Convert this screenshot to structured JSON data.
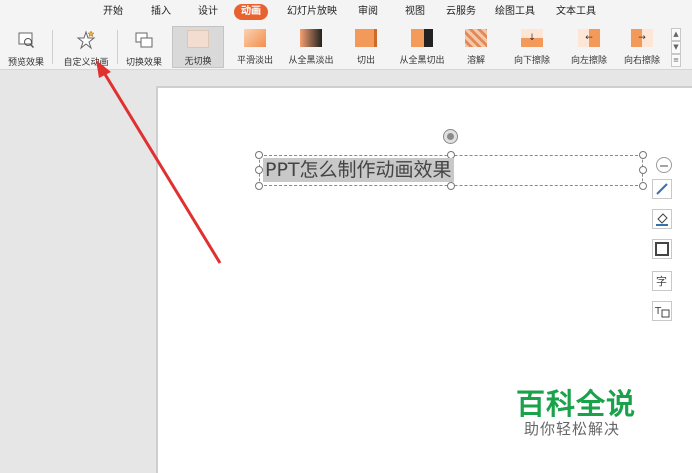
{
  "menu": {
    "tabs": [
      {
        "label": "开始"
      },
      {
        "label": "插入"
      },
      {
        "label": "设计"
      },
      {
        "label": "动画",
        "active": true
      },
      {
        "label": "幻灯片放映"
      },
      {
        "label": "审阅"
      },
      {
        "label": "视图"
      },
      {
        "label": "云服务"
      },
      {
        "label": "绘图工具"
      },
      {
        "label": "文本工具"
      }
    ]
  },
  "ribbon": {
    "preview_label": "预览效果",
    "custom_anim_label": "自定义动画",
    "switch_effect_label": "切换效果",
    "gallery": [
      {
        "label": "无切换",
        "selected": true
      },
      {
        "label": "平滑淡出"
      },
      {
        "label": "从全黑淡出"
      },
      {
        "label": "切出"
      },
      {
        "label": "从全黑切出"
      },
      {
        "label": "溶解"
      },
      {
        "label": "向下擦除"
      },
      {
        "label": "向左擦除"
      },
      {
        "label": "向右擦除"
      }
    ]
  },
  "slide": {
    "title_text": "PPT怎么制作动画效果"
  },
  "watermark": {
    "brand": "百科全说",
    "tagline": "助你轻松解决"
  },
  "colors": {
    "accent_tab": "#e8622f",
    "arrow": "#e03030",
    "watermark_green": "#19a24a"
  }
}
